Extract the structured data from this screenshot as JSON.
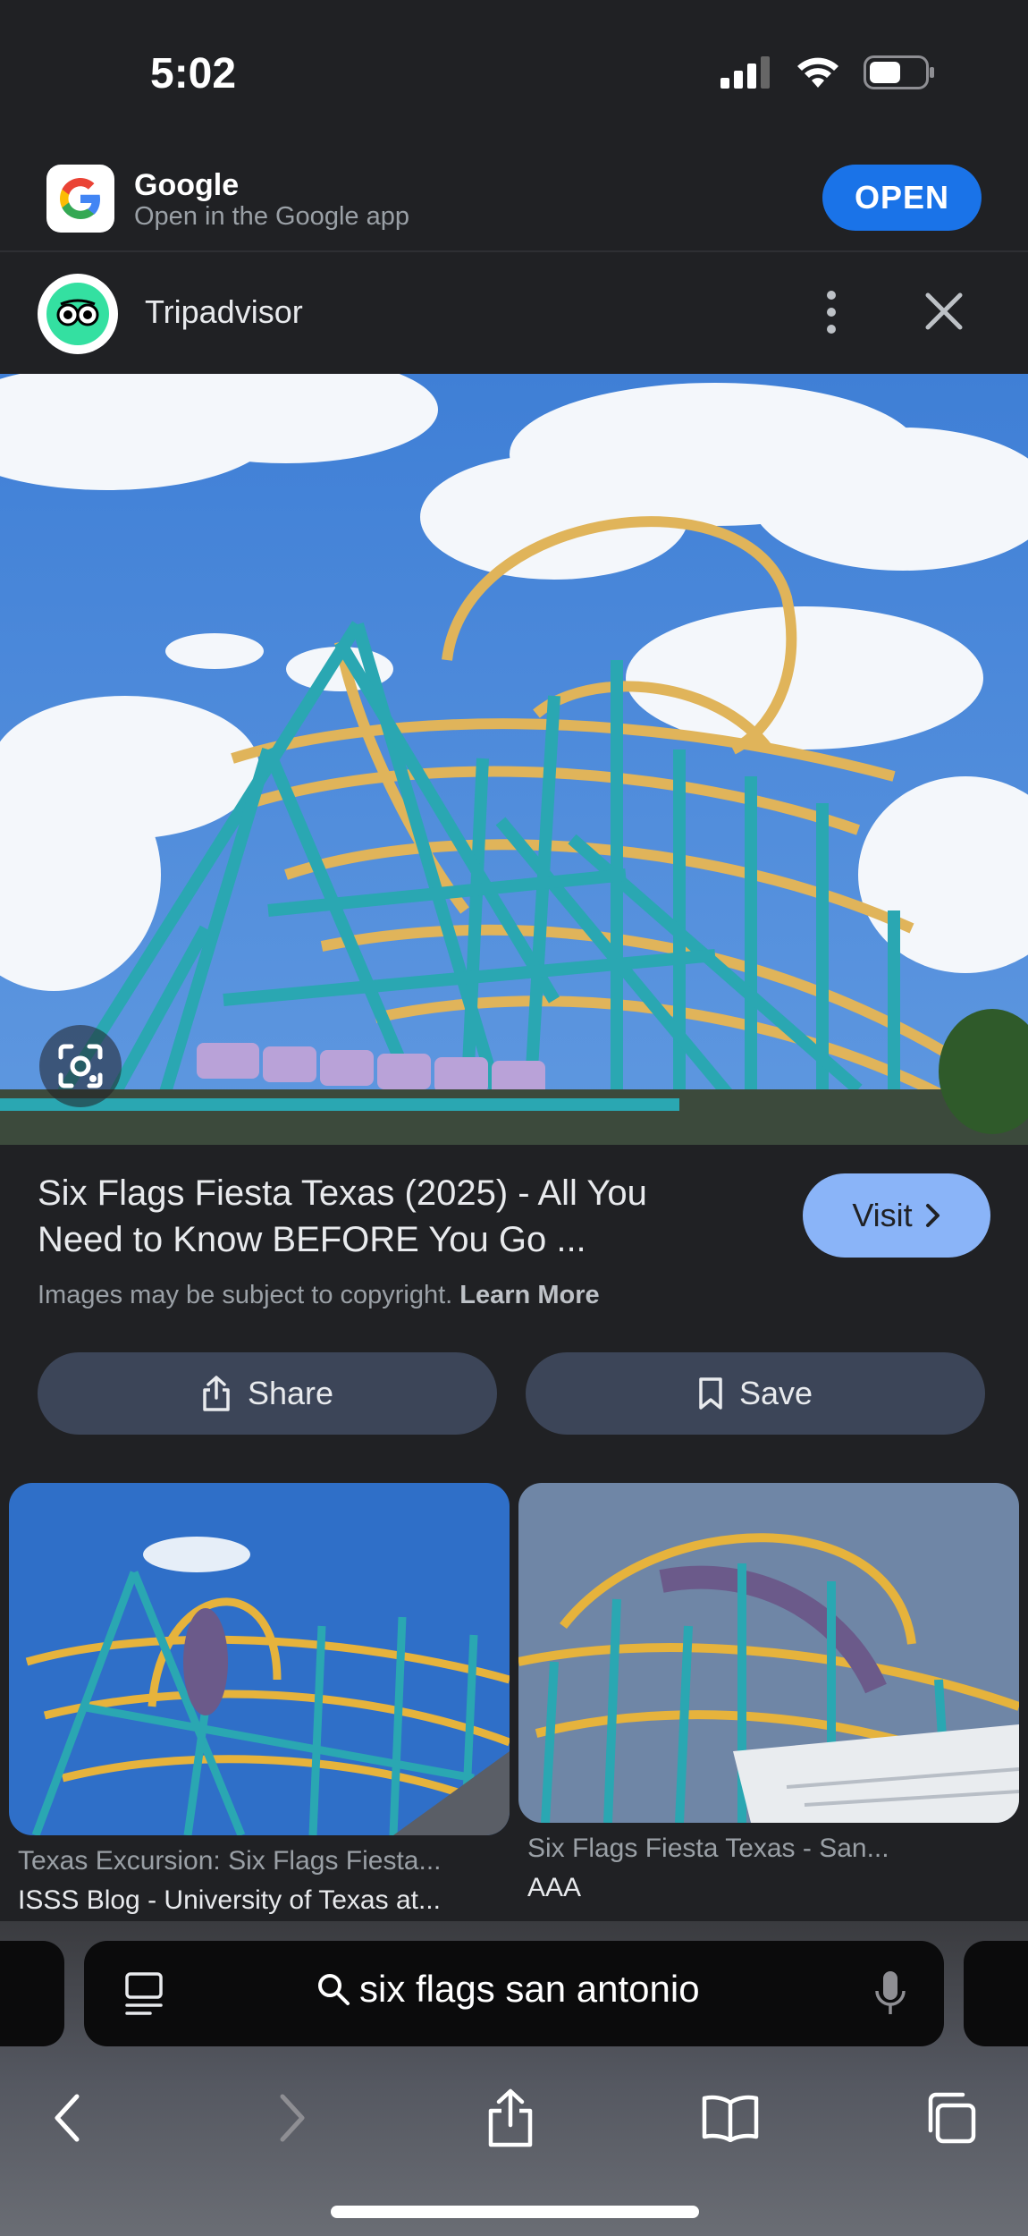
{
  "status_bar": {
    "time": "5:02"
  },
  "google_banner": {
    "title": "Google",
    "subtitle": "Open in the Google app",
    "open_label": "OPEN"
  },
  "site_header": {
    "name": "Tripadvisor"
  },
  "result": {
    "title": "Six Flags Fiesta Texas (2025) - All You Need to Know BEFORE You Go ...",
    "visit_label": "Visit",
    "copyright_text": "Images may be subject to copyright.",
    "learn_more": "Learn More",
    "share_label": "Share",
    "save_label": "Save"
  },
  "related": [
    {
      "title": "Texas Excursion: Six Flags Fiesta...",
      "source": "ISSS Blog - University of Texas at..."
    },
    {
      "title": "Six Flags Fiesta Texas - San...",
      "source": "AAA"
    }
  ],
  "address_bar": {
    "query": "six flags san antonio"
  },
  "colors": {
    "accent_blue": "#1a73e8",
    "visit_blue": "#8ab4f8",
    "track_teal": "#2aa7b2",
    "track_gold": "#e0b45a"
  },
  "icons": [
    "signal-icon",
    "wifi-icon",
    "battery-icon",
    "google-logo-icon",
    "tripadvisor-owl-icon",
    "more-vert-icon",
    "close-icon",
    "lens-icon",
    "chevron-right-icon",
    "share-icon",
    "bookmark-icon",
    "reader-icon",
    "search-icon",
    "mic-icon",
    "back-icon",
    "forward-icon",
    "share-icon",
    "bookmarks-icon",
    "tabs-icon"
  ]
}
